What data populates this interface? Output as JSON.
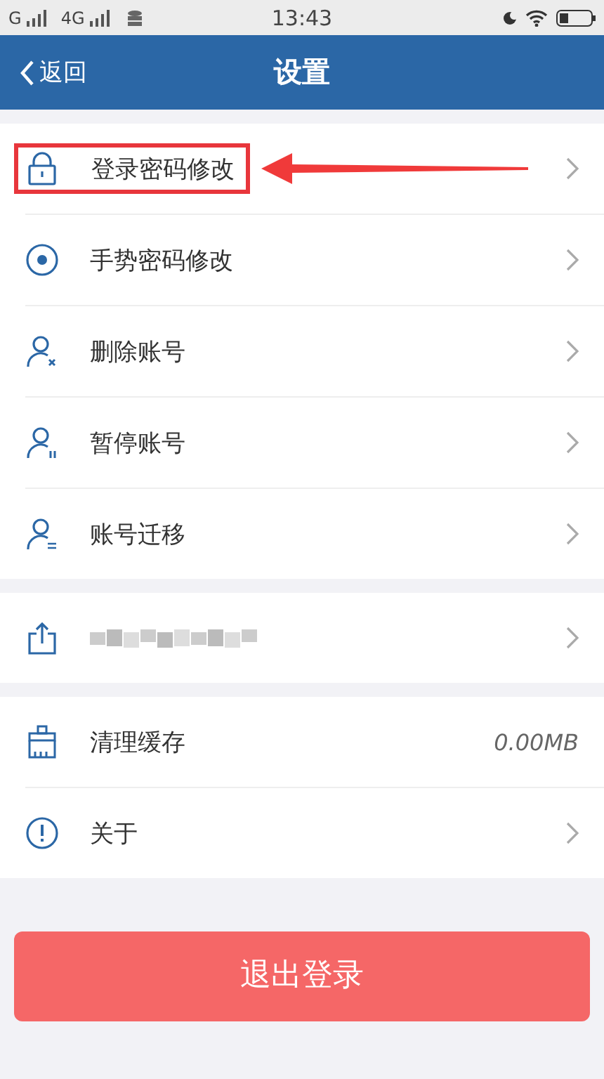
{
  "status_bar": {
    "carrier_1": "G",
    "carrier_2": "4G",
    "time": "13:43"
  },
  "header": {
    "back": "返回",
    "title": "设置"
  },
  "groups": [
    {
      "items": [
        {
          "kind": "link",
          "label": "登录密码修改",
          "highlighted": true
        },
        {
          "kind": "link",
          "label": "手势密码修改",
          "highlighted": false
        },
        {
          "kind": "link",
          "label": "删除账号",
          "highlighted": false
        },
        {
          "kind": "link",
          "label": "暂停账号",
          "highlighted": false
        },
        {
          "kind": "link",
          "label": "账号迁移",
          "highlighted": false
        }
      ]
    },
    {
      "items": [
        {
          "kind": "redacted",
          "highlighted": false
        }
      ]
    },
    {
      "items": [
        {
          "kind": "value",
          "label": "清理缓存",
          "value": "0.00MB",
          "highlighted": false
        },
        {
          "kind": "link",
          "label": "关于",
          "highlighted": false
        }
      ]
    }
  ],
  "logout_button": "退出登录"
}
